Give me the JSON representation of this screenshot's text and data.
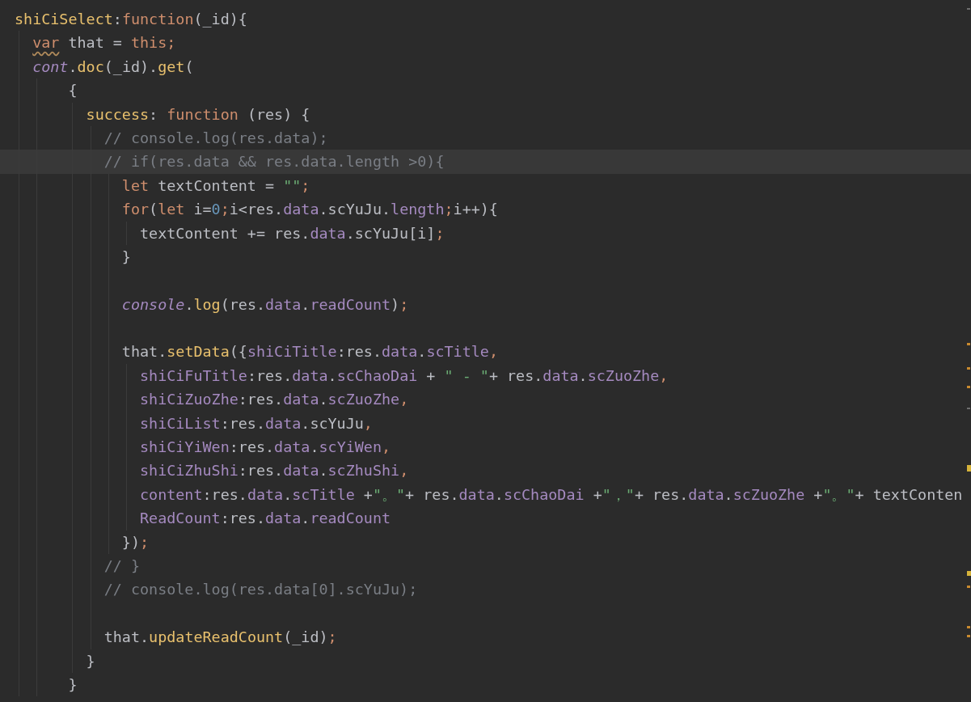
{
  "editor": {
    "lines": [
      {
        "kind": "code",
        "current": false,
        "tokens": [
          {
            "kind": "func",
            "text": "shiCiSelect"
          },
          {
            "kind": "plain",
            "text": ":"
          },
          {
            "kind": "keyword",
            "text": "function"
          },
          {
            "kind": "plain",
            "text": "(_id){"
          }
        ],
        "children": [
          {
            "kind": "code",
            "current": false,
            "tokens": [
              {
                "kind": "keyword_warning",
                "text": "var"
              },
              {
                "kind": "plain",
                "text": " that = "
              },
              {
                "kind": "keyword",
                "text": "this"
              },
              {
                "kind": "accent",
                "text": ";"
              }
            ]
          },
          {
            "kind": "code",
            "current": false,
            "tokens": [
              {
                "kind": "global",
                "text": "cont"
              },
              {
                "kind": "plain",
                "text": "."
              },
              {
                "kind": "func",
                "text": "doc"
              },
              {
                "kind": "plain",
                "text": "(_id)."
              },
              {
                "kind": "func",
                "text": "get"
              },
              {
                "kind": "plain",
                "text": "("
              }
            ],
            "children": [
              {
                "kind": "code",
                "current": false,
                "tokens": [
                  {
                    "kind": "plain",
                    "text": "{"
                  }
                ],
                "children": [
                  {
                    "kind": "code",
                    "current": false,
                    "tokens": [
                      {
                        "kind": "func",
                        "text": "success"
                      },
                      {
                        "kind": "plain",
                        "text": ": "
                      },
                      {
                        "kind": "keyword",
                        "text": "function"
                      },
                      {
                        "kind": "plain",
                        "text": " (res) {"
                      }
                    ],
                    "children": [
                      {
                        "kind": "code",
                        "current": false,
                        "tokens": [
                          {
                            "kind": "comment",
                            "text": "// console.log(res.data);"
                          }
                        ]
                      },
                      {
                        "kind": "code",
                        "current": true,
                        "tokens": [
                          {
                            "kind": "comment",
                            "text": "// if(res.data && res.data.length >0){"
                          }
                        ],
                        "children": [
                          {
                            "kind": "code",
                            "current": false,
                            "tokens": [
                              {
                                "kind": "keyword",
                                "text": "let"
                              },
                              {
                                "kind": "plain",
                                "text": " textContent = "
                              },
                              {
                                "kind": "string",
                                "text": "\"\""
                              },
                              {
                                "kind": "accent",
                                "text": ";"
                              }
                            ]
                          },
                          {
                            "kind": "code",
                            "current": false,
                            "tokens": [
                              {
                                "kind": "keyword",
                                "text": "for"
                              },
                              {
                                "kind": "plain",
                                "text": "("
                              },
                              {
                                "kind": "keyword",
                                "text": "let"
                              },
                              {
                                "kind": "plain",
                                "text": " i="
                              },
                              {
                                "kind": "number",
                                "text": "0"
                              },
                              {
                                "kind": "accent",
                                "text": ";"
                              },
                              {
                                "kind": "plain",
                                "text": "i<res."
                              },
                              {
                                "kind": "prop",
                                "text": "data"
                              },
                              {
                                "kind": "plain",
                                "text": ".scYuJu."
                              },
                              {
                                "kind": "prop",
                                "text": "length"
                              },
                              {
                                "kind": "accent",
                                "text": ";"
                              },
                              {
                                "kind": "plain",
                                "text": "i++){"
                              }
                            ],
                            "children": [
                              {
                                "kind": "code",
                                "current": false,
                                "tokens": [
                                  {
                                    "kind": "plain",
                                    "text": "textContent += res."
                                  },
                                  {
                                    "kind": "prop",
                                    "text": "data"
                                  },
                                  {
                                    "kind": "plain",
                                    "text": ".scYuJu[i]"
                                  },
                                  {
                                    "kind": "accent",
                                    "text": ";"
                                  }
                                ]
                              }
                            ]
                          },
                          {
                            "kind": "code",
                            "current": false,
                            "tokens": [
                              {
                                "kind": "plain",
                                "text": "}"
                              }
                            ]
                          },
                          {
                            "kind": "blank"
                          },
                          {
                            "kind": "code",
                            "current": false,
                            "tokens": [
                              {
                                "kind": "global",
                                "text": "console"
                              },
                              {
                                "kind": "plain",
                                "text": "."
                              },
                              {
                                "kind": "func",
                                "text": "log"
                              },
                              {
                                "kind": "plain",
                                "text": "(res."
                              },
                              {
                                "kind": "prop",
                                "text": "data"
                              },
                              {
                                "kind": "plain",
                                "text": "."
                              },
                              {
                                "kind": "prop",
                                "text": "readCount"
                              },
                              {
                                "kind": "plain",
                                "text": ")"
                              },
                              {
                                "kind": "accent",
                                "text": ";"
                              }
                            ]
                          },
                          {
                            "kind": "blank"
                          },
                          {
                            "kind": "code",
                            "current": false,
                            "tokens": [
                              {
                                "kind": "plain",
                                "text": "that."
                              },
                              {
                                "kind": "func",
                                "text": "setData"
                              },
                              {
                                "kind": "plain",
                                "text": "({"
                              },
                              {
                                "kind": "prop",
                                "text": "shiCiTitle"
                              },
                              {
                                "kind": "plain",
                                "text": ":res."
                              },
                              {
                                "kind": "prop",
                                "text": "data"
                              },
                              {
                                "kind": "plain",
                                "text": "."
                              },
                              {
                                "kind": "prop",
                                "text": "scTitle"
                              },
                              {
                                "kind": "accent",
                                "text": ","
                              }
                            ],
                            "children": [
                              {
                                "kind": "code",
                                "current": false,
                                "tokens": [
                                  {
                                    "kind": "prop",
                                    "text": "shiCiFuTitle"
                                  },
                                  {
                                    "kind": "plain",
                                    "text": ":res."
                                  },
                                  {
                                    "kind": "prop",
                                    "text": "data"
                                  },
                                  {
                                    "kind": "plain",
                                    "text": "."
                                  },
                                  {
                                    "kind": "prop",
                                    "text": "scChaoDai"
                                  },
                                  {
                                    "kind": "plain",
                                    "text": " + "
                                  },
                                  {
                                    "kind": "string",
                                    "text": "\" - \""
                                  },
                                  {
                                    "kind": "plain",
                                    "text": "+ res."
                                  },
                                  {
                                    "kind": "prop",
                                    "text": "data"
                                  },
                                  {
                                    "kind": "plain",
                                    "text": "."
                                  },
                                  {
                                    "kind": "prop",
                                    "text": "scZuoZhe"
                                  },
                                  {
                                    "kind": "accent",
                                    "text": ","
                                  }
                                ]
                              },
                              {
                                "kind": "code",
                                "current": false,
                                "tokens": [
                                  {
                                    "kind": "prop",
                                    "text": "shiCiZuoZhe"
                                  },
                                  {
                                    "kind": "plain",
                                    "text": ":res."
                                  },
                                  {
                                    "kind": "prop",
                                    "text": "data"
                                  },
                                  {
                                    "kind": "plain",
                                    "text": "."
                                  },
                                  {
                                    "kind": "prop",
                                    "text": "scZuoZhe"
                                  },
                                  {
                                    "kind": "accent",
                                    "text": ","
                                  }
                                ]
                              },
                              {
                                "kind": "code",
                                "current": false,
                                "tokens": [
                                  {
                                    "kind": "prop",
                                    "text": "shiCiList"
                                  },
                                  {
                                    "kind": "plain",
                                    "text": ":res."
                                  },
                                  {
                                    "kind": "prop",
                                    "text": "data"
                                  },
                                  {
                                    "kind": "plain",
                                    "text": ".scYuJu"
                                  },
                                  {
                                    "kind": "accent",
                                    "text": ","
                                  }
                                ]
                              },
                              {
                                "kind": "code",
                                "current": false,
                                "tokens": [
                                  {
                                    "kind": "prop",
                                    "text": "shiCiYiWen"
                                  },
                                  {
                                    "kind": "plain",
                                    "text": ":res."
                                  },
                                  {
                                    "kind": "prop",
                                    "text": "data"
                                  },
                                  {
                                    "kind": "plain",
                                    "text": "."
                                  },
                                  {
                                    "kind": "prop",
                                    "text": "scYiWen"
                                  },
                                  {
                                    "kind": "accent",
                                    "text": ","
                                  }
                                ]
                              },
                              {
                                "kind": "code",
                                "current": false,
                                "tokens": [
                                  {
                                    "kind": "prop",
                                    "text": "shiCiZhuShi"
                                  },
                                  {
                                    "kind": "plain",
                                    "text": ":res."
                                  },
                                  {
                                    "kind": "prop",
                                    "text": "data"
                                  },
                                  {
                                    "kind": "plain",
                                    "text": "."
                                  },
                                  {
                                    "kind": "prop",
                                    "text": "scZhuShi"
                                  },
                                  {
                                    "kind": "accent",
                                    "text": ","
                                  }
                                ]
                              },
                              {
                                "kind": "code",
                                "current": false,
                                "tokens": [
                                  {
                                    "kind": "prop",
                                    "text": "content"
                                  },
                                  {
                                    "kind": "plain",
                                    "text": ":res."
                                  },
                                  {
                                    "kind": "prop",
                                    "text": "data"
                                  },
                                  {
                                    "kind": "plain",
                                    "text": "."
                                  },
                                  {
                                    "kind": "prop",
                                    "text": "scTitle"
                                  },
                                  {
                                    "kind": "plain",
                                    "text": " +"
                                  },
                                  {
                                    "kind": "string",
                                    "text": "\"。\""
                                  },
                                  {
                                    "kind": "plain",
                                    "text": "+ res."
                                  },
                                  {
                                    "kind": "prop",
                                    "text": "data"
                                  },
                                  {
                                    "kind": "plain",
                                    "text": "."
                                  },
                                  {
                                    "kind": "prop",
                                    "text": "scChaoDai"
                                  },
                                  {
                                    "kind": "plain",
                                    "text": " +"
                                  },
                                  {
                                    "kind": "string",
                                    "text": "\"，\""
                                  },
                                  {
                                    "kind": "plain",
                                    "text": "+ res."
                                  },
                                  {
                                    "kind": "prop",
                                    "text": "data"
                                  },
                                  {
                                    "kind": "plain",
                                    "text": "."
                                  },
                                  {
                                    "kind": "prop",
                                    "text": "scZuoZhe"
                                  },
                                  {
                                    "kind": "plain",
                                    "text": " +"
                                  },
                                  {
                                    "kind": "string",
                                    "text": "\"。\""
                                  },
                                  {
                                    "kind": "plain",
                                    "text": "+ textConten"
                                  }
                                ]
                              },
                              {
                                "kind": "code",
                                "current": false,
                                "tokens": [
                                  {
                                    "kind": "prop",
                                    "text": "ReadCount"
                                  },
                                  {
                                    "kind": "plain",
                                    "text": ":res."
                                  },
                                  {
                                    "kind": "prop",
                                    "text": "data"
                                  },
                                  {
                                    "kind": "plain",
                                    "text": "."
                                  },
                                  {
                                    "kind": "prop",
                                    "text": "readCount"
                                  }
                                ]
                              }
                            ]
                          },
                          {
                            "kind": "code",
                            "current": false,
                            "tokens": [
                              {
                                "kind": "plain",
                                "text": "})"
                              },
                              {
                                "kind": "accent",
                                "text": ";"
                              }
                            ]
                          }
                        ]
                      },
                      {
                        "kind": "code",
                        "current": false,
                        "tokens": [
                          {
                            "kind": "comment",
                            "text": "// }"
                          }
                        ]
                      },
                      {
                        "kind": "code",
                        "current": false,
                        "tokens": [
                          {
                            "kind": "comment",
                            "text": "// console.log(res.data[0].scYuJu);"
                          }
                        ]
                      },
                      {
                        "kind": "blank"
                      },
                      {
                        "kind": "code",
                        "current": false,
                        "tokens": [
                          {
                            "kind": "plain",
                            "text": "that."
                          },
                          {
                            "kind": "func",
                            "text": "updateReadCount"
                          },
                          {
                            "kind": "plain",
                            "text": "(_id)"
                          },
                          {
                            "kind": "accent",
                            "text": ";"
                          }
                        ]
                      }
                    ]
                  },
                  {
                    "kind": "code",
                    "current": false,
                    "tokens": [
                      {
                        "kind": "plain",
                        "text": "}"
                      }
                    ]
                  }
                ]
              },
              {
                "kind": "code",
                "current": false,
                "tokens": [
                  {
                    "kind": "plain",
                    "text": "}"
                  }
                ]
              }
            ]
          }
        ]
      }
    ]
  }
}
